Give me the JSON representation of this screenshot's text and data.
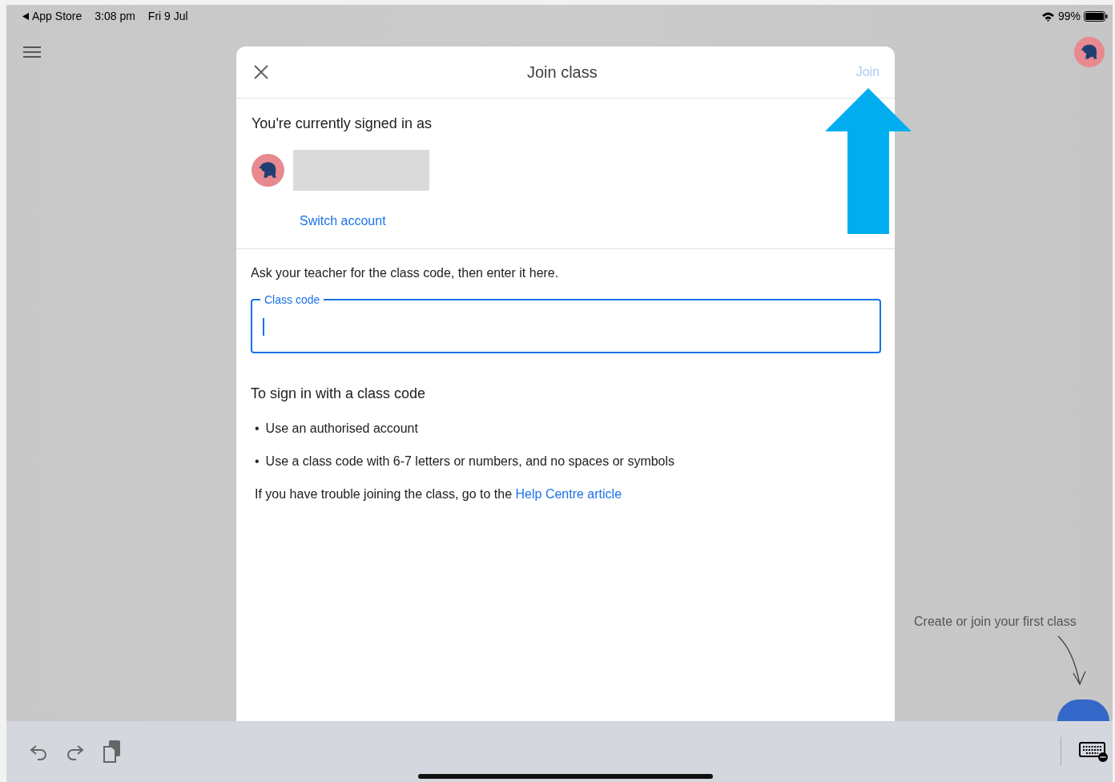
{
  "status_bar": {
    "back_label": "App Store",
    "time": "3:08 pm",
    "date": "Fri 9 Jul",
    "battery": "99%"
  },
  "dialog": {
    "title": "Join class",
    "join_button": {
      "label": "Join",
      "disabled": true
    },
    "account": {
      "heading": "You're currently signed in as",
      "switch_link": "Switch account"
    },
    "code_section": {
      "instruction": "Ask your teacher for the class code, then enter it here.",
      "field": {
        "label": "Class code",
        "focused": true
      }
    },
    "help": {
      "heading": "To sign in with a class code",
      "bullets": [
        {
          "bullet": "•",
          "text": "Use an authorised account"
        },
        {
          "bullet": "•",
          "text": "Use a class code with 6-7 letters or numbers, and no spaces or symbols"
        }
      ],
      "note": "If you have trouble joining the class, go to the",
      "link": "Help Centre article"
    }
  },
  "background": {
    "empty_hint": "Create or join your first class"
  }
}
